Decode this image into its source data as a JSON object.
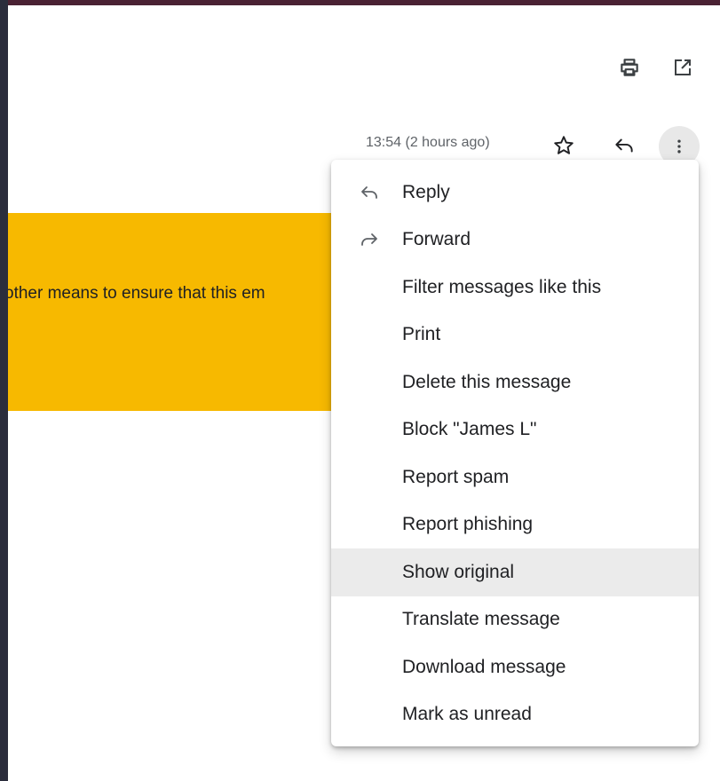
{
  "toolbar": {
    "print_icon": "printer-icon",
    "popout_icon": "open-in-new-window-icon"
  },
  "message_header": {
    "timestamp": "13:54 (2 hours ago)",
    "star_icon": "star-icon",
    "reply_icon": "reply-icon",
    "more_icon": "more-vertical-icon"
  },
  "warning_banner": {
    "text": "other means to ensure that this em",
    "color": "#f7b900"
  },
  "menu": {
    "items": [
      {
        "label": "Reply",
        "icon": "reply-icon"
      },
      {
        "label": "Forward",
        "icon": "forward-icon"
      },
      {
        "label": "Filter messages like this",
        "icon": ""
      },
      {
        "label": "Print",
        "icon": ""
      },
      {
        "label": "Delete this message",
        "icon": ""
      },
      {
        "label": "Block \"James L\"",
        "icon": ""
      },
      {
        "label": "Report spam",
        "icon": ""
      },
      {
        "label": "Report phishing",
        "icon": ""
      },
      {
        "label": "Show original",
        "icon": "",
        "highlighted": true
      },
      {
        "label": "Translate message",
        "icon": ""
      },
      {
        "label": "Download message",
        "icon": ""
      },
      {
        "label": "Mark as unread",
        "icon": ""
      }
    ]
  }
}
